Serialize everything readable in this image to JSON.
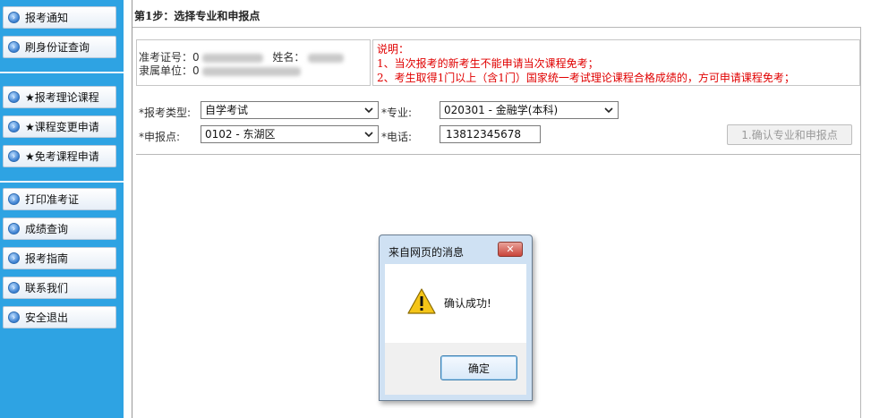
{
  "sidebar": {
    "items": [
      {
        "label": "报考通知"
      },
      {
        "label": "刷身份证查询"
      },
      {
        "label": "★报考理论课程"
      },
      {
        "label": "★课程变更申请"
      },
      {
        "label": "★免考课程申请"
      },
      {
        "label": "打印准考证"
      },
      {
        "label": "成绩查询"
      },
      {
        "label": "报考指南"
      },
      {
        "label": "联系我们"
      },
      {
        "label": "安全退出"
      }
    ]
  },
  "main": {
    "step_title": "第1步：选择专业和申报点",
    "info": {
      "exam_no_label": "准考证号：",
      "exam_no_visible": "0",
      "name_label": "姓名：",
      "unit_label": "隶属单位：",
      "unit_visible": "0"
    },
    "notes": {
      "title": "说明：",
      "line1": "1、当次报考的新考生不能申请当次课程免考；",
      "line2": "2、考生取得1门以上（含1门）国家统一考试理论课程合格成绩的，方可申请课程免考；"
    },
    "form": {
      "exam_type_label": "*报考类型:",
      "exam_type_value": "自学考试",
      "major_label": "*专业:",
      "major_value": "020301 - 金融学(本科)",
      "site_label": "*申报点:",
      "site_value": "0102 - 东湖区",
      "phone_label": "*电话:",
      "phone_value": "13812345678",
      "confirm_button": "1.确认专业和申报点"
    }
  },
  "dialog": {
    "title": "来自网页的消息",
    "message": "确认成功!",
    "ok_label": "确定",
    "close_glyph": "✕"
  },
  "colors": {
    "sidebar_bg": "#2ea3e3",
    "note_text": "#e00000",
    "dialog_frame": "#cfe1f3"
  }
}
